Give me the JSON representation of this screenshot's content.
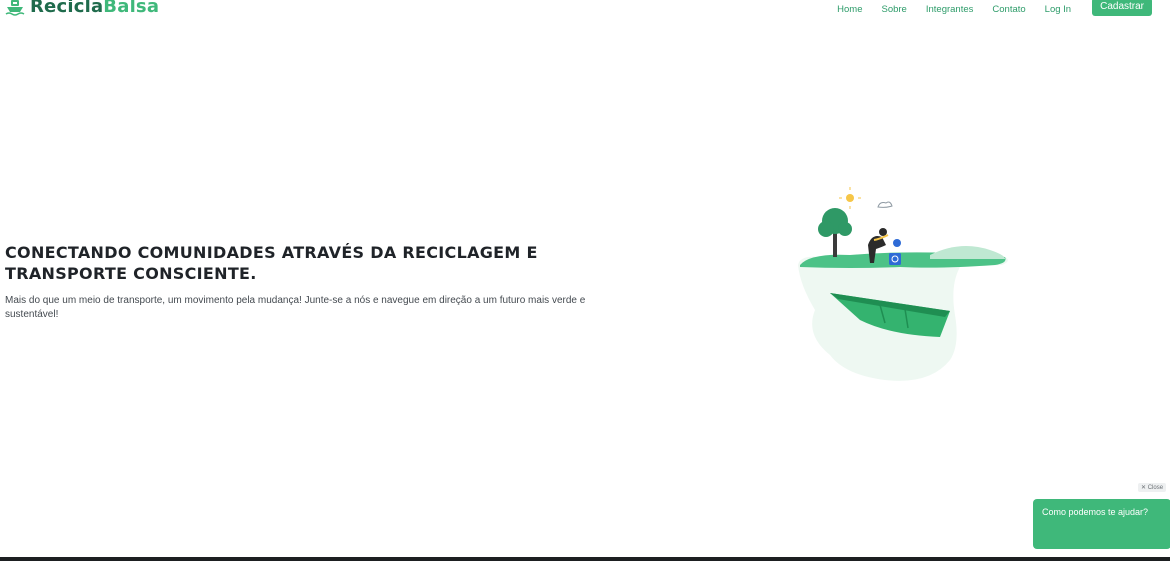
{
  "header": {
    "logo_part1": "Recicla",
    "logo_part2": "Balsa",
    "logo_icon": "boat-icon",
    "nav": {
      "home": "Home",
      "sobre": "Sobre",
      "integrantes": "Integrantes",
      "contato": "Contato",
      "login": "Log In",
      "cadastrar": "Cadastrar"
    }
  },
  "hero": {
    "title": "CONECTANDO COMUNIDADES ATRAVÉS DA RECICLAGEM E TRANSPORTE CONSCIENTE.",
    "text": "Mais do que um meio de transporte, um movimento pela mudança! Junte-se a nós e navegue em direção a um futuro mais verde e sustentável!",
    "illustration": "recycling-boat-illustration"
  },
  "chat": {
    "close_label": "✕ Close",
    "message": "Como podemos te ajudar?"
  },
  "colors": {
    "brand_dark": "#1f6b4c",
    "brand": "#3fb87a",
    "text_dark": "#1f2328"
  }
}
